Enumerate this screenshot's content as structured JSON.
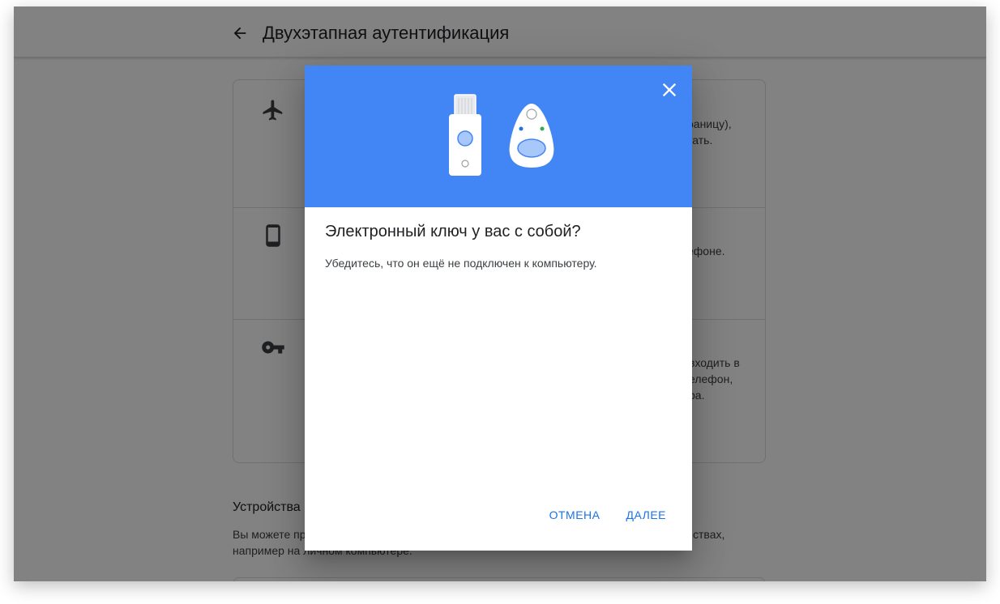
{
  "header": {
    "title": "Двухэтапная аутентификация"
  },
  "options": [
    {
      "icon": "airplane-icon",
      "text_fragment": "раницу),",
      "text_fragment2": "тать."
    },
    {
      "icon": "phone-icon",
      "text_fragment": "ефоне."
    },
    {
      "icon": "key-icon",
      "text_fragment": "входить в",
      "text_fragment2": "елефон,",
      "text_fragment3": "ра."
    }
  ],
  "devices_section": {
    "title_fragment": "Устройства",
    "desc_start": "Вы можете пр",
    "desc_end": "ствах,",
    "desc_line2": "например на личном компьютере."
  },
  "dialog": {
    "title": "Электронный ключ у вас с собой?",
    "body": "Убедитесь, что он ещё не подключен к компьютеру.",
    "cancel_label": "ОТМЕНА",
    "next_label": "ДАЛЕЕ"
  },
  "colors": {
    "hero_blue": "#4285f4",
    "button_blue": "#1a73e8",
    "scrim": "rgba(0,0,0,0.49)"
  }
}
